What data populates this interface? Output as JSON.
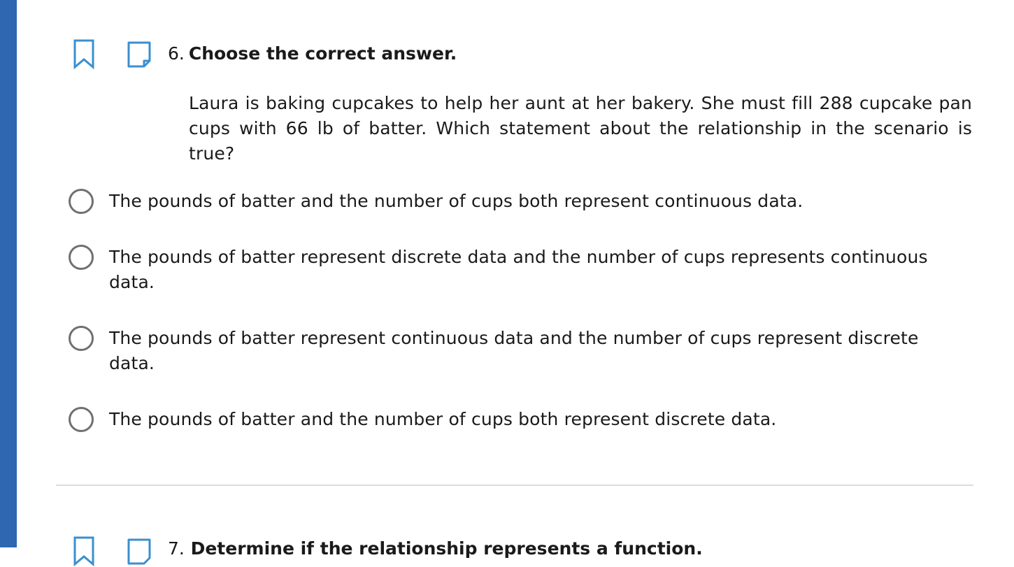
{
  "question": {
    "number": "6.",
    "instruction": "Choose the correct answer.",
    "prompt": "Laura is baking cupcakes to help her aunt at her bakery. She must fill 288 cupcake pan cups with 66 lb of batter. Which statement about the relationship in the scenario is true?",
    "icons": {
      "bookmark": "bookmark-icon",
      "note": "note-icon"
    },
    "options": [
      {
        "label": "The pounds of batter and the number of cups both represent continuous data."
      },
      {
        "label": "The pounds of batter represent discrete data and the number of cups represents continuous data."
      },
      {
        "label": "The pounds of batter represent continuous data and the number of cups represent discrete data."
      },
      {
        "label": "The pounds of batter and the number of cups both represent discrete data."
      }
    ]
  },
  "next_question": {
    "number": "7.",
    "instruction": "Determine if the relationship represents a function."
  },
  "colors": {
    "accent": "#2f68b0",
    "icon_blue": "#3a8fd0",
    "radio_border": "#707070",
    "divider": "#dcdcdc"
  }
}
